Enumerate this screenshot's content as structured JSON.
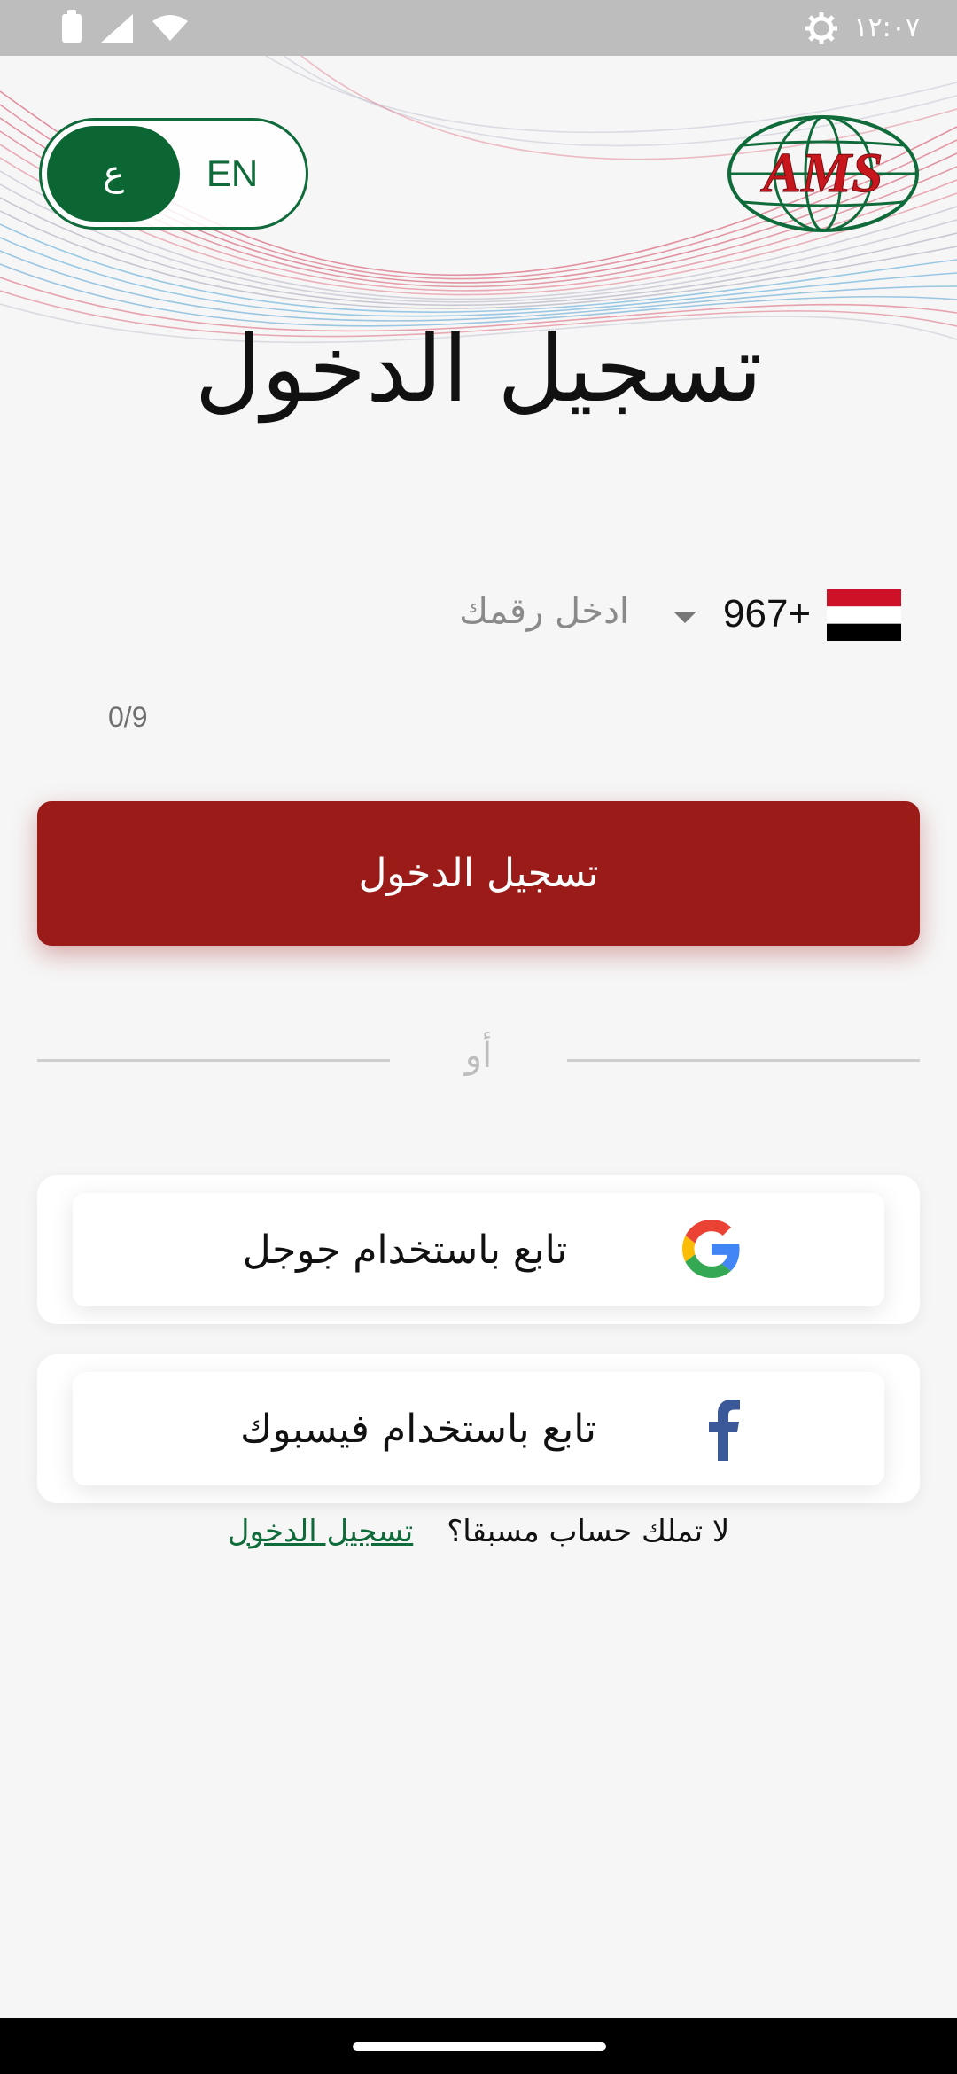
{
  "status_bar": {
    "time": "١٢:٠٧",
    "icons": [
      "battery-icon",
      "signal-icon",
      "wifi-icon",
      "settings-icon"
    ]
  },
  "language_toggle": {
    "arabic_label": "ع",
    "english_label": "EN",
    "selected": "arabic"
  },
  "logo": {
    "text": "AMS"
  },
  "title": "تسجيل الدخول",
  "phone": {
    "country_flag": "Yemen",
    "country_code": "+967",
    "placeholder": "ادخل رقمك",
    "value": "",
    "counter": "0/9"
  },
  "login_button": {
    "label": "تسجيل الدخول"
  },
  "divider": {
    "text": "أو"
  },
  "social": {
    "google_label": "تابع باستخدام جوجل",
    "facebook_label": "تابع باستخدام فيسبوك"
  },
  "register": {
    "question": "لا تملك حساب مسبقا؟",
    "link": "تسجيل الدخول"
  },
  "colors": {
    "primary_green": "#0b6634",
    "primary_red": "#9a1b17",
    "background": "#f6f6f6"
  }
}
